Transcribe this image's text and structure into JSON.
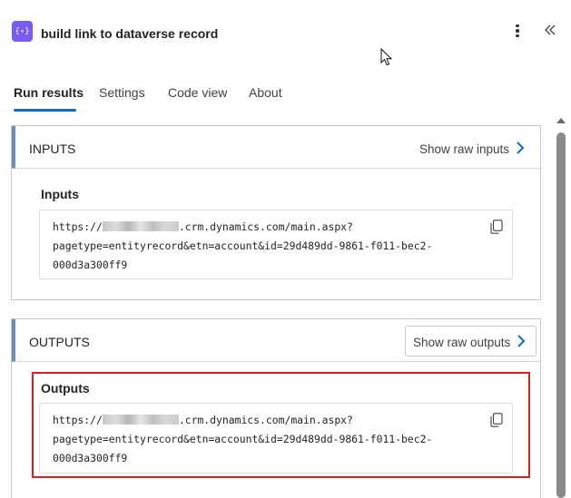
{
  "header": {
    "icon_glyph": "{∘}",
    "title": "build link to dataverse record",
    "more_icon": "more-vertical-icon",
    "collapse_icon": "double-chevron-left-icon"
  },
  "tabs": [
    {
      "label": "Run results",
      "active": true
    },
    {
      "label": "Settings",
      "active": false
    },
    {
      "label": "Code view",
      "active": false
    },
    {
      "label": "About",
      "active": false
    }
  ],
  "inputs_section": {
    "title": "INPUTS",
    "raw_link": "Show raw inputs",
    "field_label": "Inputs",
    "value_prefix": "https://",
    "value_line1_rest": ".crm.dynamics.com/main.aspx?",
    "value_line2": "pagetype=entityrecord&etn=account&id=29d489dd-9861-f011-bec2-",
    "value_line3": "000d3a300ff9"
  },
  "outputs_section": {
    "title": "OUTPUTS",
    "raw_link": "Show raw outputs",
    "field_label": "Outputs",
    "value_prefix": "https://",
    "value_line1_rest": ".crm.dynamics.com/main.aspx?",
    "value_line2": "pagetype=entityrecord&etn=account&id=29d489dd-9861-f011-bec2-",
    "value_line3": "000d3a300ff9"
  },
  "colors": {
    "accent": "#0f6cbd",
    "action_icon": "#7a5af0",
    "highlight": "#d7201f",
    "section_bar": "#6a8fb3"
  }
}
